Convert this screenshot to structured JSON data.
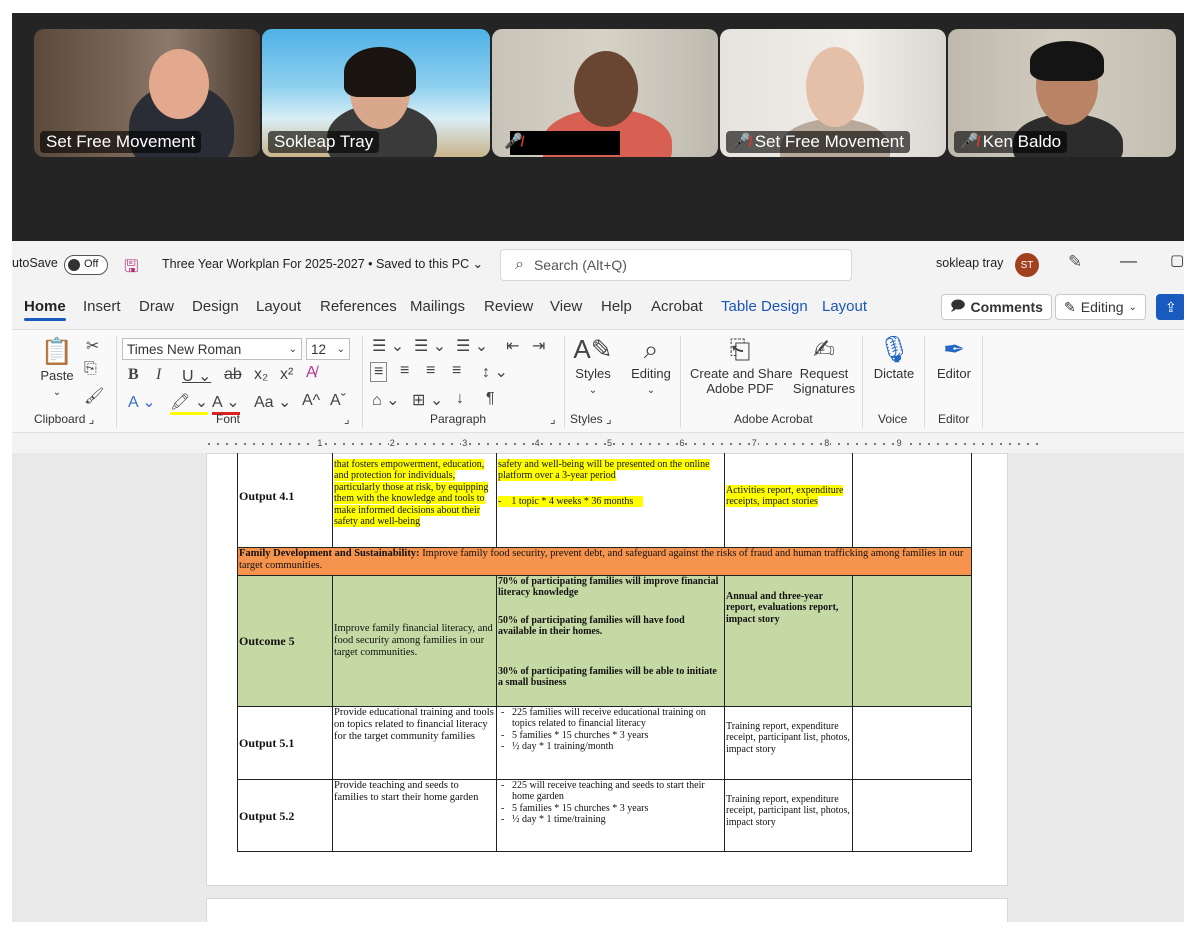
{
  "participants": [
    {
      "name": "Set Free Movement",
      "muted": false,
      "active": false
    },
    {
      "name": "Sokleap Tray",
      "muted": false,
      "active": true
    },
    {
      "name": "",
      "muted": true,
      "active": false
    },
    {
      "name": "Set Free Movement",
      "muted": true,
      "active": false
    },
    {
      "name": "Ken Baldo",
      "muted": true,
      "active": false
    }
  ],
  "word": {
    "autosave_label": "utoSave",
    "autosave_state": "Off",
    "doc_title": "Three Year Workplan For 2025-2027 • Saved to this PC",
    "search_placeholder": "Search (Alt+Q)",
    "user_name": "sokleap tray",
    "user_initials": "ST",
    "tabs": [
      "Home",
      "Insert",
      "Draw",
      "Design",
      "Layout",
      "References",
      "Mailings",
      "Review",
      "View",
      "Help",
      "Acrobat",
      "Table Design",
      "Layout"
    ],
    "comments_label": "Comments",
    "editing_label": "Editing",
    "ribbon": {
      "paste": "Paste",
      "clipboard": "Clipboard",
      "font_name": "Times New Roman",
      "font_size": "12",
      "font": "Font",
      "paragraph": "Paragraph",
      "styles": "Styles",
      "styles_group": "Styles",
      "editing": "Editing",
      "create_share_1": "Create and Share",
      "create_share_2": "Adobe PDF",
      "request_1": "Request",
      "request_2": "Signatures",
      "adobe_acrobat": "Adobe Acrobat",
      "dictate": "Dictate",
      "voice": "Voice",
      "editor": "Editor",
      "editor_group": "Editor"
    },
    "ruler_numbers": [
      "1",
      "2",
      "3",
      "4",
      "5",
      "6",
      "7",
      "8",
      "9"
    ]
  },
  "table": {
    "output41": {
      "label": "Output 4.1",
      "activity": "that fosters empowerment, education, and protection for individuals, particularly those at risk, by equipping them with the knowledge and tools to make informed decisions about their safety and well-being",
      "indicator_1": "safety and well-being will be presented on the online platform over a 3-year period",
      "indicator_2": "1 topic * 4 weeks * 36 months",
      "verification": "Activities report, expenditure receipts, impact stories"
    },
    "family_header_bold": "Family Development and Sustainability:",
    "family_header_rest": " Improve family food security, prevent debt, and safeguard against the risks of fraud and human trafficking among families in our target communities.",
    "outcome5": {
      "label": "Outcome 5",
      "description": "Improve family financial literacy, and food security among families in our target communities.",
      "indicator_1": "70% of participating families will improve financial literacy knowledge",
      "indicator_2": "50% of participating families will have food available in their homes.",
      "indicator_3": "30% of participating families will be able to initiate a small business",
      "verification": "Annual and three-year report, evaluations report, impact story"
    },
    "output51": {
      "label": "Output 5.1",
      "activity": "Provide educational training and tools on topics related to financial literacy for the target community families",
      "bullets": [
        "225 families will receive educational training on topics related to financial literacy",
        "5 families * 15 churches * 3 years",
        "½ day * 1 training/month"
      ],
      "verification": "Training report, expenditure receipt, participant list, photos, impact story"
    },
    "output52": {
      "label": "Output 5.2",
      "activity": "Provide teaching and seeds to families to start their home garden",
      "bullets": [
        "225 will receive teaching and seeds to start their home garden",
        "5 families * 15 churches * 3 years",
        "½ day * 1 time/training"
      ],
      "verification": "Training report, expenditure receipt, participant list, photos, impact story"
    }
  }
}
